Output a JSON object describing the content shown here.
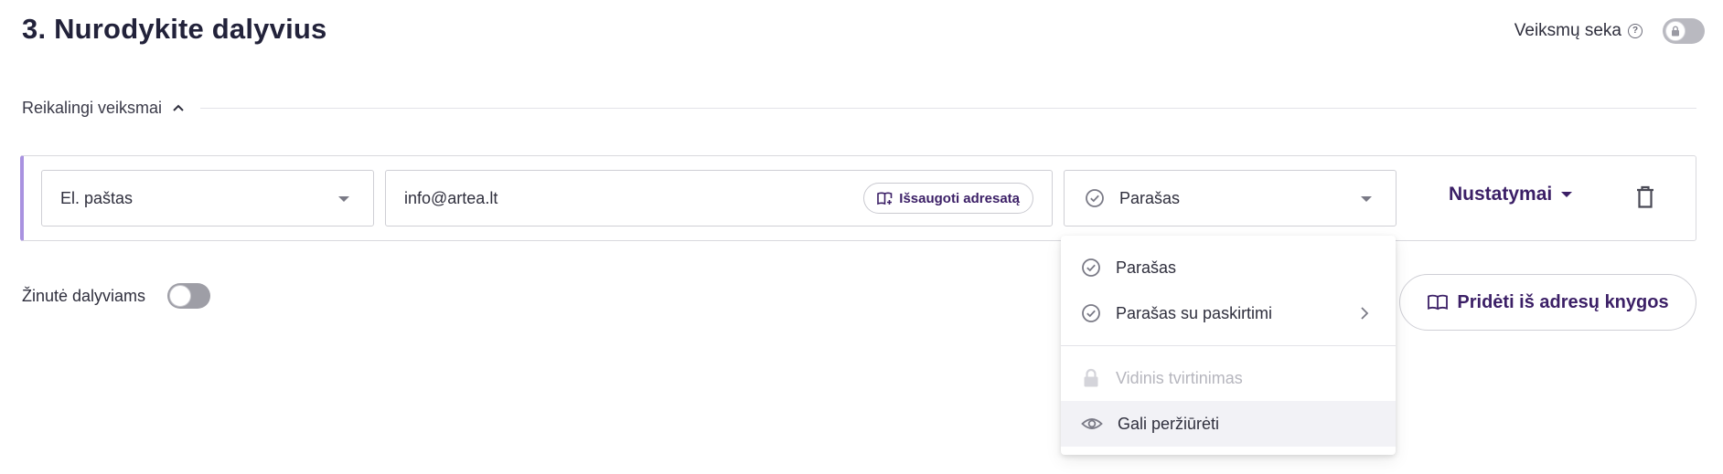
{
  "header": {
    "title": "3. Nurodykite dalyvius",
    "sequence_label": "Veiksmų seka",
    "help_icon": "help-circle-icon",
    "sequence_toggle_on": false
  },
  "section": {
    "label": "Reikalingi veiksmai",
    "expanded": true
  },
  "participant": {
    "type_select": {
      "value": "El. paštas"
    },
    "email_input": {
      "value": "info@artea.lt"
    },
    "save_contact_label": "Išsaugoti adresatą",
    "action_select": {
      "value": "Parašas"
    },
    "settings_label": "Nustatymai",
    "delete_icon": "trash-icon"
  },
  "message": {
    "label": "Žinutė dalyviams",
    "enabled": false
  },
  "add_from_book_label": "Pridėti iš adresų knygos",
  "action_menu": {
    "items": [
      {
        "label": "Parašas",
        "icon": "check-circle-icon",
        "disabled": false,
        "submenu": false
      },
      {
        "label": "Parašas su paskirtimi",
        "icon": "check-circle-icon",
        "disabled": false,
        "submenu": true
      },
      {
        "label": "Vidinis tvirtinimas",
        "icon": "lock-icon",
        "disabled": true,
        "submenu": false
      },
      {
        "label": "Gali peržiūrėti",
        "icon": "eye-icon",
        "disabled": false,
        "submenu": false,
        "hovered": true
      }
    ]
  },
  "colors": {
    "accent": "#3b1f66",
    "row_left_border": "#a992e0"
  }
}
